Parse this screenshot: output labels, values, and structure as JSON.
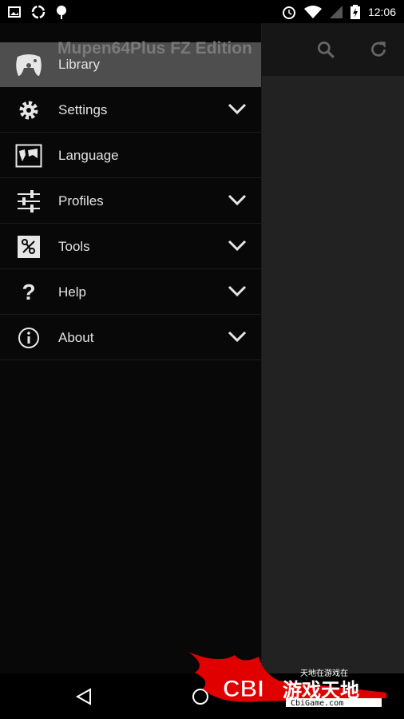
{
  "status_bar": {
    "time": "12:06",
    "icons_left": [
      "image-icon",
      "sync-icon",
      "android-icon"
    ],
    "icons_right": [
      "alarm-icon",
      "wifi-icon",
      "signal-icon",
      "battery-charging-icon"
    ]
  },
  "app_bar": {
    "title": "Mupen64Plus FZ Edition",
    "actions": [
      "search-icon",
      "refresh-icon"
    ]
  },
  "drawer": {
    "items": [
      {
        "label": "Library",
        "icon": "gamepad-icon",
        "expandable": false,
        "selected": true
      },
      {
        "label": "Settings",
        "icon": "gear-icon",
        "expandable": true
      },
      {
        "label": "Language",
        "icon": "world-map-icon",
        "expandable": false
      },
      {
        "label": "Profiles",
        "icon": "sliders-icon",
        "expandable": true
      },
      {
        "label": "Tools",
        "icon": "tools-icon",
        "expandable": true
      },
      {
        "label": "Help",
        "icon": "question-icon",
        "expandable": true
      },
      {
        "label": "About",
        "icon": "info-icon",
        "expandable": true
      }
    ]
  },
  "nav_bar": [
    "back-icon",
    "home-icon"
  ],
  "watermark": {
    "text": "CBI游戏天地",
    "subtitle": "天地在游戏在",
    "url": "CbiGame.com"
  },
  "colors": {
    "selected_row": "#5a5a5a",
    "drawer_bg": "#080808",
    "content_bg": "#222222",
    "watermark_red": "#e00000"
  }
}
